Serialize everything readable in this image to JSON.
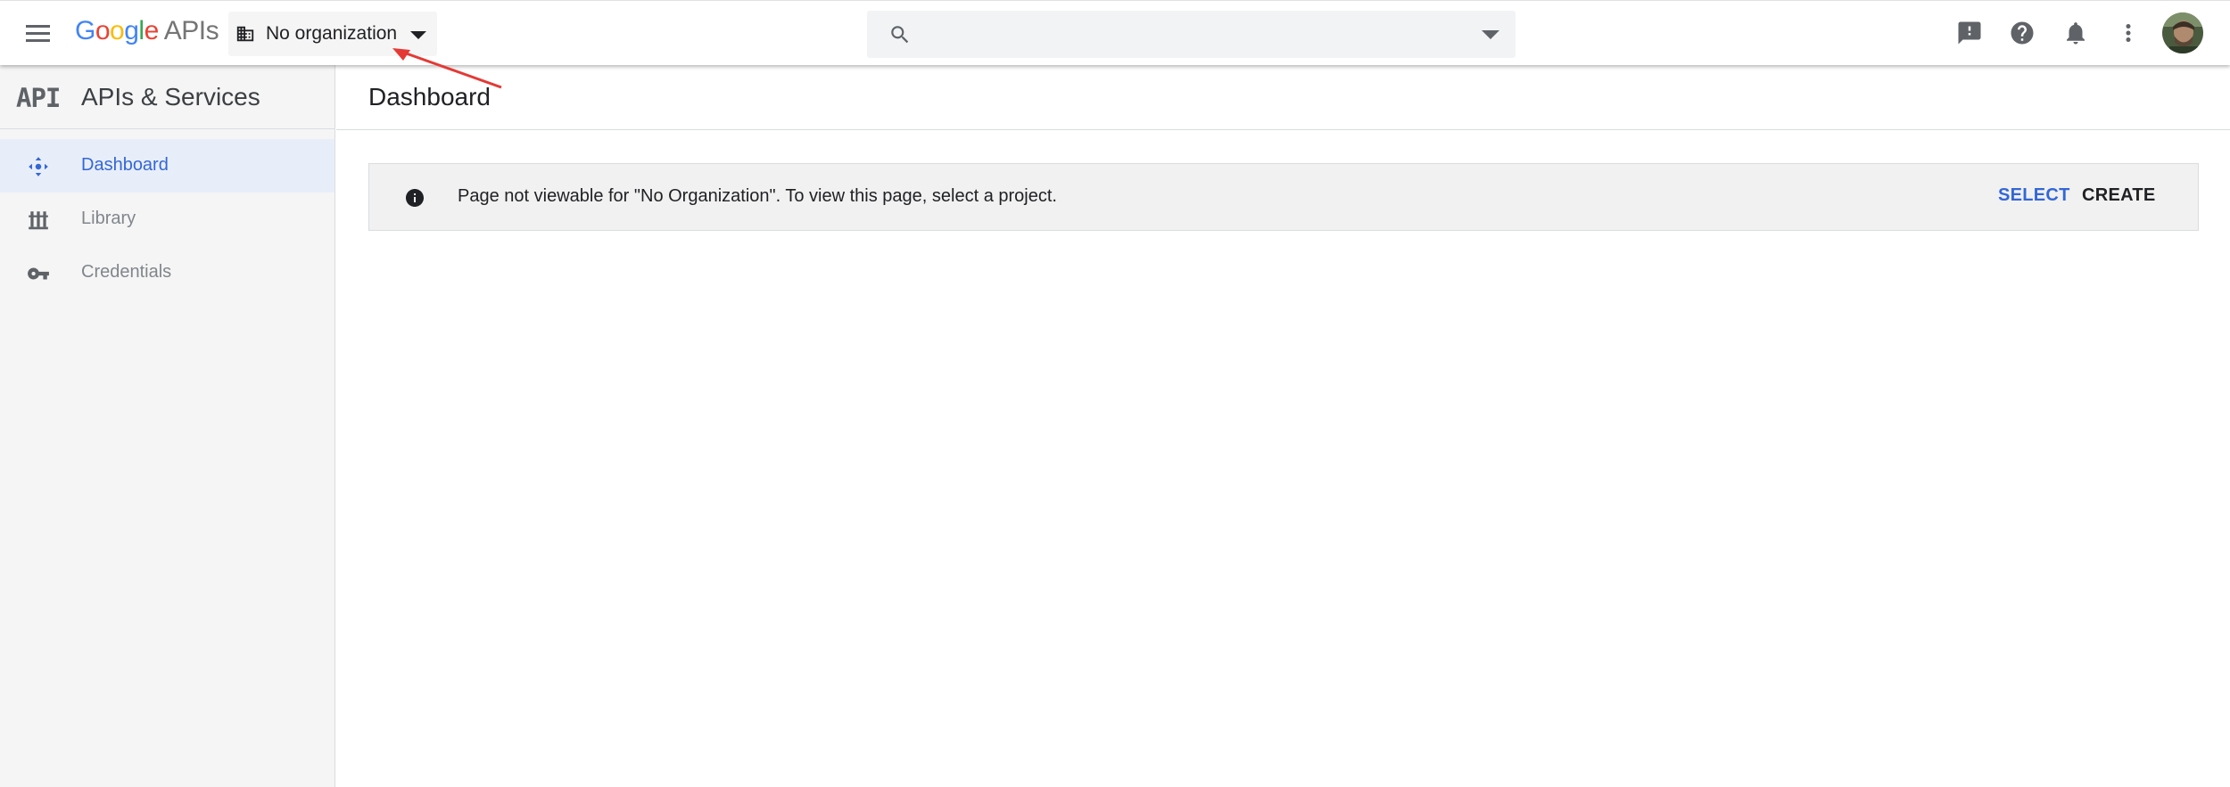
{
  "header": {
    "logo": {
      "g1": "G",
      "o1": "o",
      "o2": "o",
      "g2": "g",
      "l": "l",
      "e": "e",
      "suffix": "APIs"
    },
    "org_selector": {
      "label": "No organization"
    },
    "search": {
      "value": "",
      "placeholder": ""
    },
    "icons": [
      "menu-icon",
      "building-icon",
      "search-icon",
      "feedback-icon",
      "help-icon",
      "notifications-icon",
      "more-vert-icon",
      "avatar"
    ]
  },
  "sidebar": {
    "logo_text": "API",
    "title": "APIs & Services",
    "items": [
      {
        "label": "Dashboard",
        "icon": "dashboard-icon",
        "active": true
      },
      {
        "label": "Library",
        "icon": "library-icon",
        "active": false
      },
      {
        "label": "Credentials",
        "icon": "key-icon",
        "active": false
      }
    ]
  },
  "main": {
    "title": "Dashboard",
    "notice": {
      "message": "Page not viewable for \"No Organization\". To view this page, select a project.",
      "select_label": "SELECT",
      "create_label": "CREATE"
    }
  },
  "colors": {
    "accent": "#3367d6",
    "active_bg": "#e8eef9",
    "sidebar_bg": "#f5f5f5",
    "annotation_arrow": "#e53935"
  }
}
